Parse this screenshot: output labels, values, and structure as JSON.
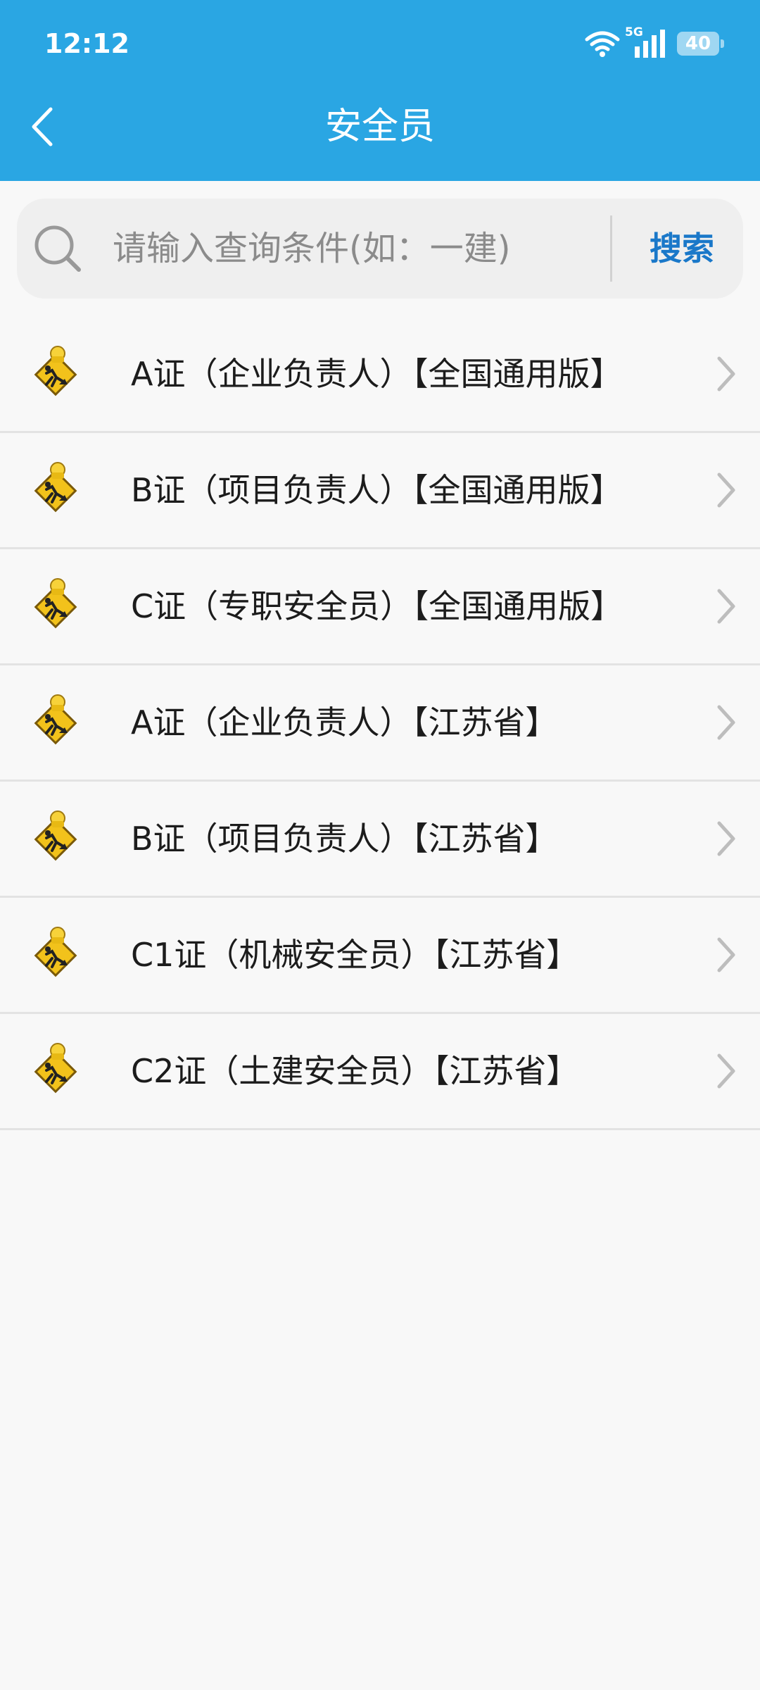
{
  "status_bar": {
    "time": "12:12",
    "network": "5G",
    "battery": "40"
  },
  "header": {
    "title": "安全员"
  },
  "search": {
    "placeholder": "请输入查询条件(如：一建)",
    "button_label": "搜索"
  },
  "list": {
    "items": [
      {
        "label": "A证（企业负责人）【全国通用版】",
        "icon": "construction-worker-sign-icon"
      },
      {
        "label": "B证（项目负责人）【全国通用版】",
        "icon": "construction-worker-sign-icon"
      },
      {
        "label": "C证（专职安全员）【全国通用版】",
        "icon": "construction-worker-sign-icon"
      },
      {
        "label": "A证（企业负责人）【江苏省】",
        "icon": "construction-worker-sign-icon"
      },
      {
        "label": "B证（项目负责人）【江苏省】",
        "icon": "construction-worker-sign-icon"
      },
      {
        "label": "C1证（机械安全员）【江苏省】",
        "icon": "construction-worker-sign-icon"
      },
      {
        "label": "C2证（土建安全员）【江苏省】",
        "icon": "construction-worker-sign-icon"
      }
    ]
  },
  "colors": {
    "header_bg": "#2aa6e3",
    "search_accent": "#1a78c9",
    "page_bg": "#f8f8f8"
  }
}
